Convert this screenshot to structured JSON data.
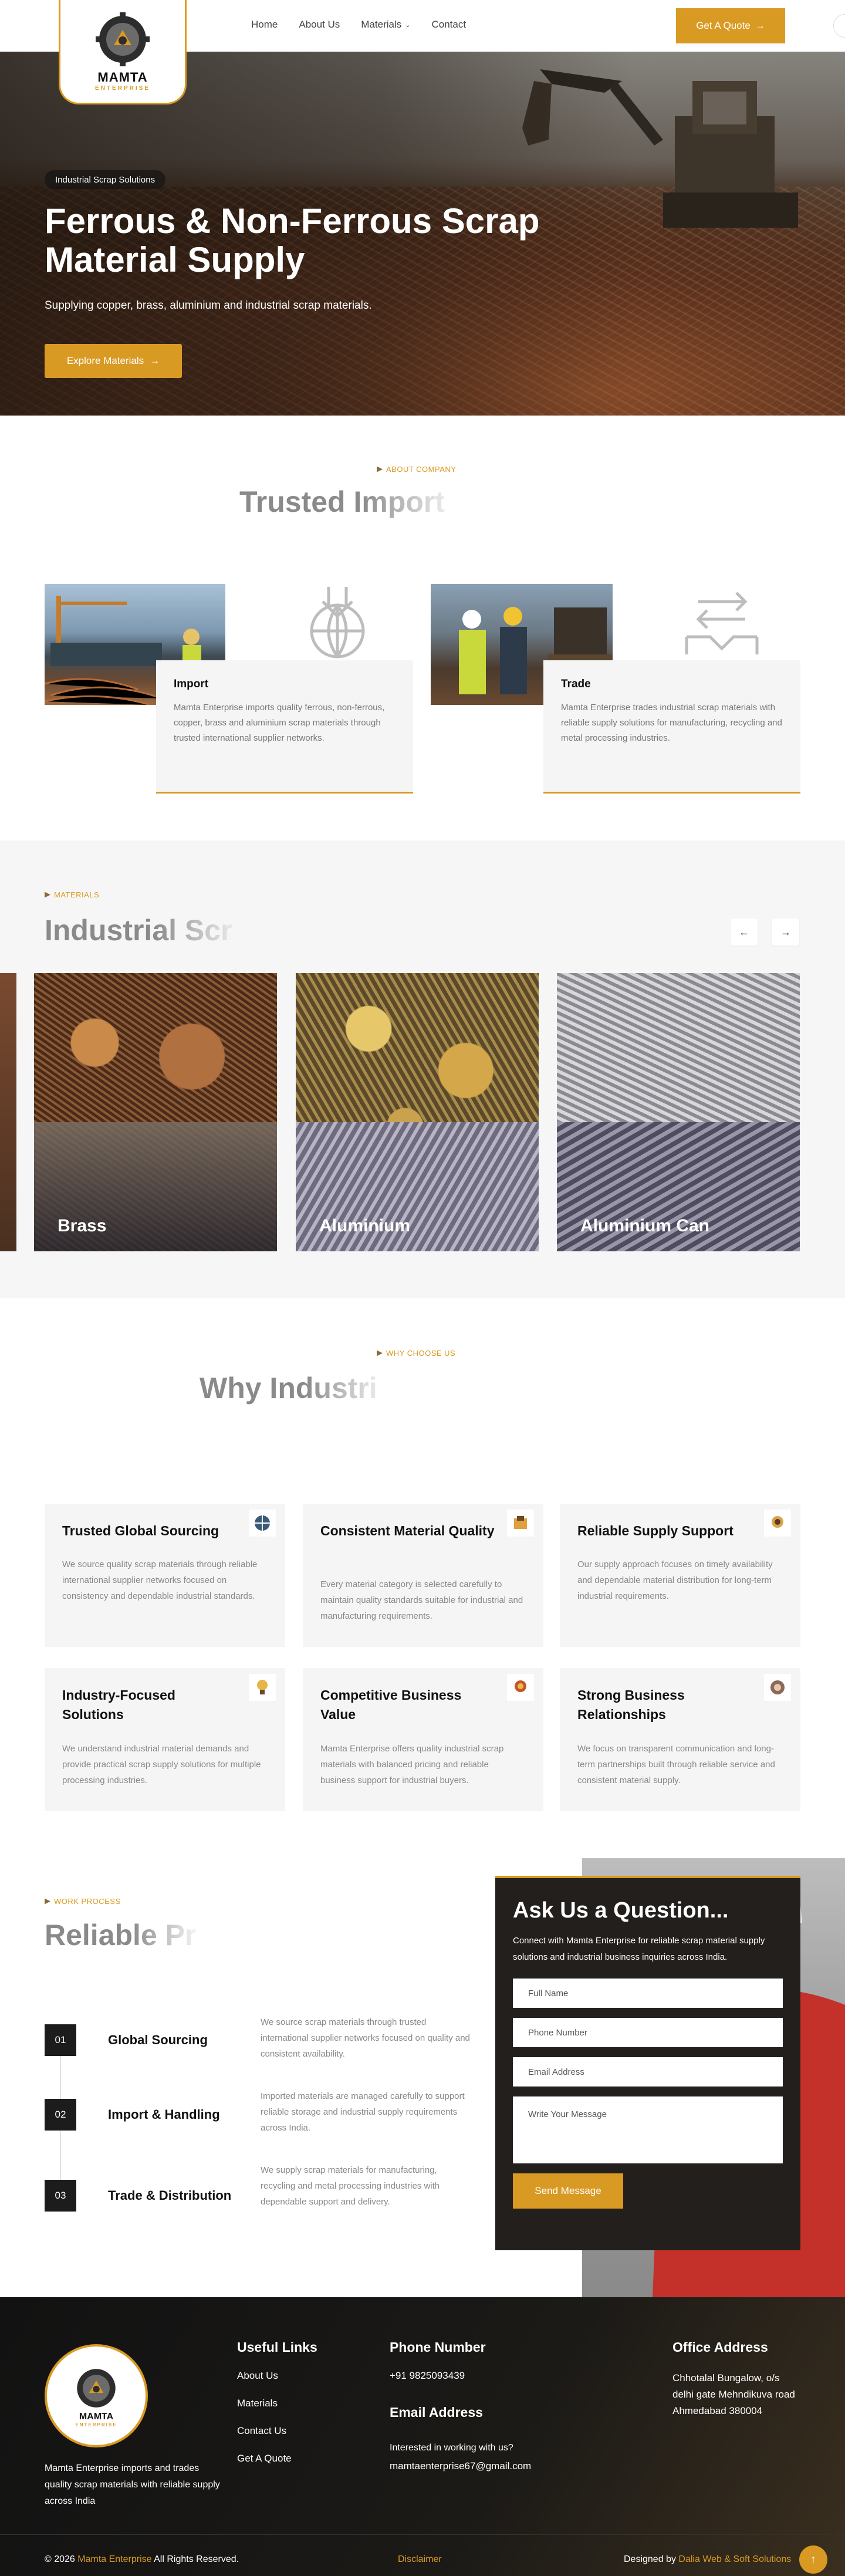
{
  "header": {
    "logo_name": "MAMTA",
    "logo_sub": "ENTERPRISE",
    "nav": [
      {
        "label": "Home"
      },
      {
        "label": "About Us"
      },
      {
        "label": "Materials"
      },
      {
        "label": "Contact"
      }
    ],
    "cta": "Get A Quote"
  },
  "hero": {
    "badge": "Industrial Scrap Solutions",
    "title": "Ferrous & Non-Ferrous Scrap Material Supply",
    "subtitle": "Supplying copper, brass, aluminium and industrial scrap materials.",
    "button": "Explore Materials"
  },
  "about": {
    "eyebrow": "ABOUT COMPANY",
    "title": "Trusted Import",
    "cards": [
      {
        "title": "Import",
        "text": "Mamta Enterprise imports quality ferrous, non-ferrous, copper, brass and aluminium scrap materials through trusted international supplier networks."
      },
      {
        "title": "Trade",
        "text": "Mamta Enterprise trades industrial scrap materials with reliable supply solutions for manufacturing, recycling and metal processing industries."
      }
    ]
  },
  "materials": {
    "eyebrow": "MATERIALS",
    "title": "Industrial Scr",
    "items": [
      {
        "label": "Brass"
      },
      {
        "label": "Aluminium"
      },
      {
        "label": "Aluminium Can"
      }
    ]
  },
  "why": {
    "eyebrow": "WHY CHOOSE US",
    "title": "Why Industri",
    "cards": [
      {
        "title": "Trusted Global Sourcing",
        "text": "We source quality scrap materials through reliable international supplier networks focused on consistency and dependable industrial standards."
      },
      {
        "title": "Consistent Material Quality",
        "text": "Every material category is selected carefully to maintain quality standards suitable for industrial and manufacturing requirements."
      },
      {
        "title": "Reliable Supply Support",
        "text": "Our supply approach focuses on timely availability and dependable material distribution for long-term industrial requirements."
      },
      {
        "title": "Industry-Focused Solutions",
        "text": "We understand industrial material demands and provide practical scrap supply solutions for multiple processing industries."
      },
      {
        "title": "Competitive Business Value",
        "text": "Mamta Enterprise offers quality industrial scrap materials with balanced pricing and reliable business support for industrial buyers."
      },
      {
        "title": "Strong Business Relationships",
        "text": "We focus on transparent communication and long-term partnerships built through reliable service and consistent material supply."
      }
    ]
  },
  "process": {
    "eyebrow": "WORK PROCESS",
    "title": "Reliable Pr",
    "steps": [
      {
        "num": "01",
        "title": "Global Sourcing",
        "text": "We source scrap materials through trusted international supplier networks focused on quality and consistent availability."
      },
      {
        "num": "02",
        "title": "Import & Handling",
        "text": "Imported materials are managed carefully to support reliable storage and industrial supply requirements across India."
      },
      {
        "num": "03",
        "title": "Trade & Distribution",
        "text": "We supply scrap materials for manufacturing, recycling and metal processing industries with dependable support and delivery."
      }
    ]
  },
  "form": {
    "title": "Ask Us a Question...",
    "intro": "Connect with Mamta Enterprise for reliable scrap material supply solutions and industrial business inquiries across India.",
    "placeholders": [
      "Full Name",
      "Phone Number",
      "Email Address",
      "Write Your Message"
    ],
    "button": "Send Message"
  },
  "footer": {
    "about": "Mamta Enterprise imports and trades quality scrap materials with reliable supply across India",
    "links_title": "Useful Links",
    "links": [
      "About Us",
      "Materials",
      "Contact Us",
      "Get A Quote"
    ],
    "phone_title": "Phone Number",
    "phone": "+91 9825093439",
    "email_title": "Email Address",
    "email_note": "Interested in working with us?",
    "email": "mamtaenterprise67@gmail.com",
    "office_title": "Office Address",
    "office": "Chhotalal Bungalow, o/s delhi gate Mehndikuva road Ahmedabad 380004",
    "copyright_prefix": "© 2026",
    "copyright_brand": "Mamta Enterprise",
    "copyright_suffix": "All Rights Reserved.",
    "disclaimer": "Disclaimer",
    "designed_prefix": "Designed by",
    "designed_by": "Dalia Web & Soft Solutions"
  },
  "colors": {
    "accent": "#d99a23",
    "dark": "#1c1c1c"
  }
}
